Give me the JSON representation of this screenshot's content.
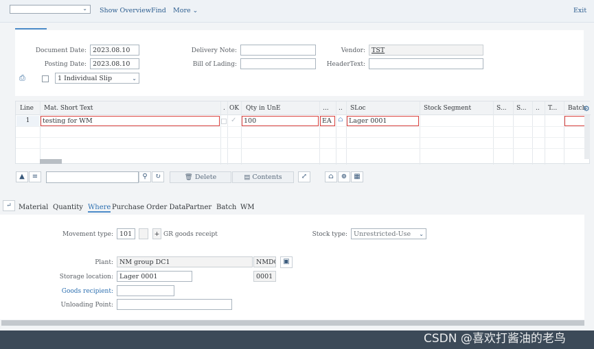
{
  "toolbar": {
    "dropdown_value": "",
    "show_overview": "Show Overview",
    "find": "Find",
    "more": "More",
    "exit": "Exit"
  },
  "header": {
    "document_date_label": "Document Date:",
    "document_date": "2023.08.10",
    "posting_date_label": "Posting Date:",
    "posting_date": "2023.08.10",
    "delivery_note_label": "Delivery Note:",
    "delivery_note": "",
    "bill_of_lading_label": "Bill of Lading:",
    "bill_of_lading": "",
    "vendor_label": "Vendor:",
    "vendor": "TST",
    "header_text_label": "HeaderText:",
    "header_text": "",
    "slip_select": "1 Individual Slip"
  },
  "grid": {
    "columns": [
      "Line",
      "Mat. Short Text",
      ".",
      "OK",
      "Qty in UnE",
      "...",
      "..",
      "SLoc",
      "Stock Segment",
      "S...",
      "S...",
      "..",
      "T...",
      "Batch"
    ],
    "rows": [
      {
        "line": "1",
        "mat_short_text": "testing for WM",
        "qty": "100",
        "unit": "EA",
        "sloc": "Lager 0001"
      }
    ]
  },
  "grid_toolbar": {
    "search_placeholder": "",
    "delete_label": "Delete",
    "contents_label": "Contents"
  },
  "tabs": [
    "Material",
    "Quantity",
    "Where",
    "Purchase Order Data",
    "Partner",
    "Batch",
    "WM"
  ],
  "detail": {
    "movement_type_label": "Movement type:",
    "movement_type": "101",
    "movement_sign": "+",
    "movement_desc": "GR goods receipt",
    "stock_type_label": "Stock type:",
    "stock_type": "Unrestricted-Use",
    "plant_label": "Plant:",
    "plant": "NM group DC1",
    "plant_code": "NMDC",
    "storage_location_label": "Storage location:",
    "storage_location": "Lager 0001",
    "storage_location_code": "0001",
    "goods_recipient_label": "Goods recipient:",
    "goods_recipient": "",
    "unloading_point_label": "Unloading Point:",
    "unloading_point": ""
  },
  "watermark": "CSDN @喜欢打酱油的老鸟",
  "colors": {
    "accent": "#4c8bc9",
    "error_border": "#d9403c",
    "footer": "#3c4a58"
  }
}
